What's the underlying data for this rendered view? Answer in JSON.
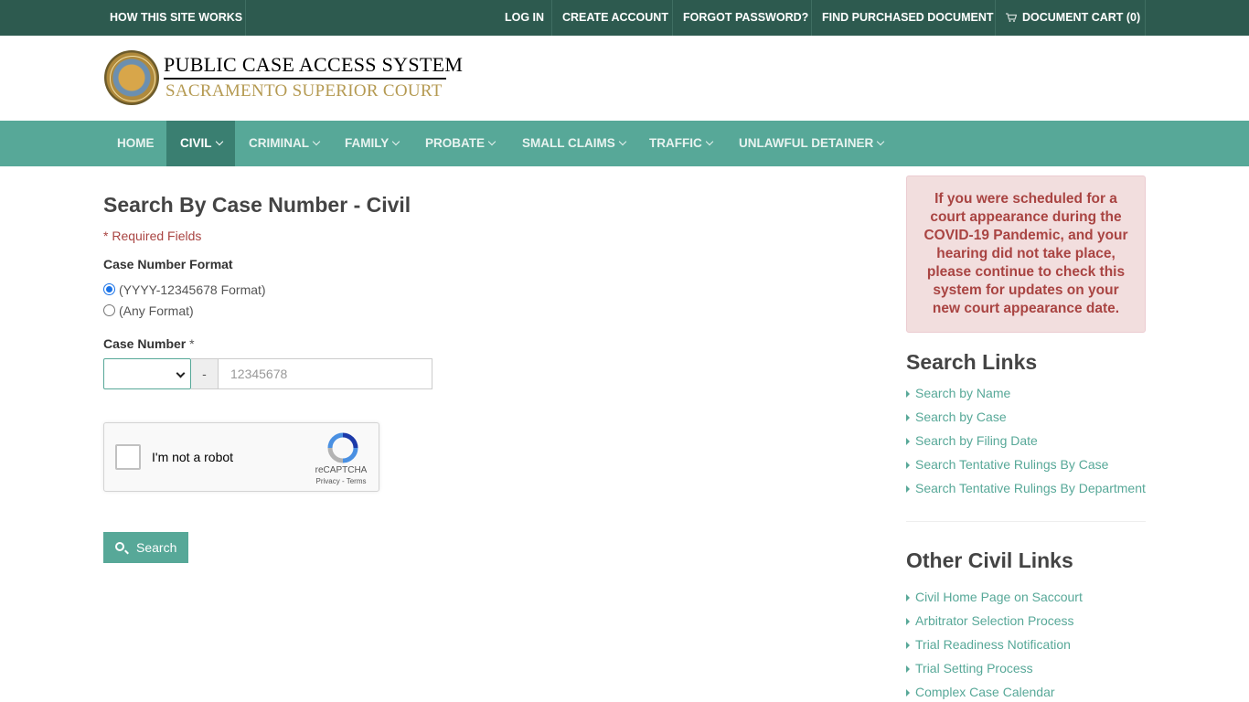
{
  "topbar": {
    "how": "HOW THIS SITE WORKS",
    "login": "LOG IN",
    "create": "CREATE ACCOUNT",
    "forgot": "FORGOT PASSWORD?",
    "find": "FIND PURCHASED DOCUMENT",
    "cart": "DOCUMENT CART (0)"
  },
  "header": {
    "title": "PUBLIC CASE ACCESS SYSTEM",
    "subtitle": "SACRAMENTO SUPERIOR COURT"
  },
  "nav": {
    "home": "HOME",
    "civil": "CIVIL",
    "criminal": "CRIMINAL",
    "family": "FAMILY",
    "probate": "PROBATE",
    "small_claims": "SMALL CLAIMS",
    "traffic": "TRAFFIC",
    "unlawful": "UNLAWFUL DETAINER"
  },
  "form": {
    "title": "Search By Case Number - Civil",
    "required_note": "* Required Fields",
    "format_label": "Case Number Format",
    "format_options": [
      "(YYYY-12345678 Format)",
      "(Any Format)"
    ],
    "case_number_label": "Case Number",
    "required_star": "*",
    "dash": "-",
    "case_number_placeholder": "12345678",
    "captcha_text": "I'm not a robot",
    "captcha_brand": "reCAPTCHA",
    "captcha_terms": "Privacy - Terms",
    "search_button": "Search"
  },
  "sidebar": {
    "alert": "If you were scheduled for a court appearance during the COVID-19 Pandemic, and your hearing did not take place, please continue to check this system for updates on your new court appearance date.",
    "search_links_title": "Search Links",
    "search_links": [
      "Search by Name",
      "Search by Case",
      "Search by Filing Date",
      "Search Tentative Rulings By Case",
      "Search Tentative Rulings By Department"
    ],
    "other_links_title": "Other Civil Links",
    "other_links": [
      "Civil Home Page on Saccourt",
      "Arbitrator Selection Process",
      "Trial Readiness Notification",
      "Trial Setting Process",
      "Complex Case Calendar"
    ]
  },
  "colors": {
    "topbar": "#2d5a4f",
    "nav": "#57a898",
    "nav_active": "#3a7f71",
    "link": "#57a898",
    "alert_text": "#a94442",
    "subtitle_gold": "#b59a52"
  }
}
